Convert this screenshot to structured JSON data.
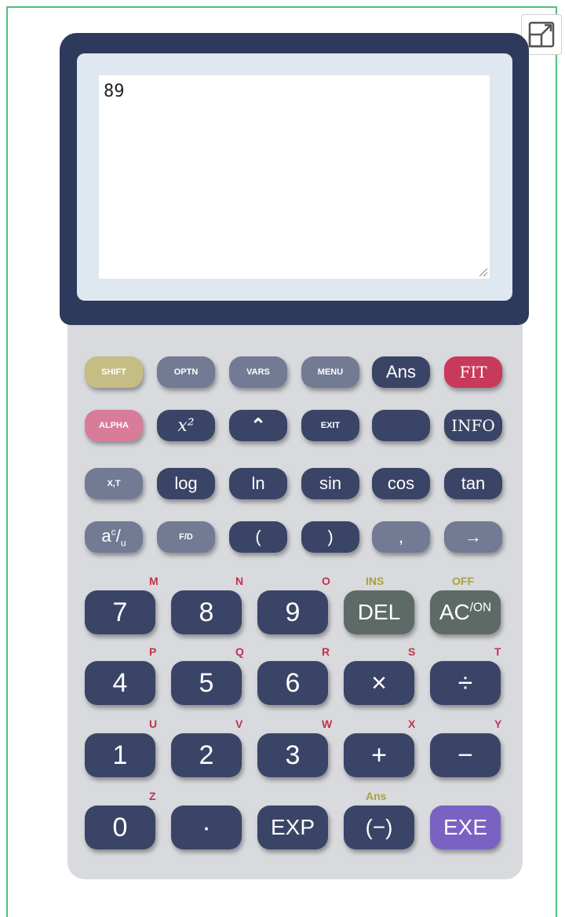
{
  "display": {
    "value": "89"
  },
  "colors": {
    "housing": "#2e3a5c",
    "navy_key": "#3a4466",
    "grey_key": "#737a93",
    "shift": "#c5bd84",
    "alpha": "#d87c99",
    "fit": "#c83a5a",
    "del_ac": "#5e6a66",
    "exe": "#7a62c2",
    "sub_red": "#c2324e",
    "sub_olive": "#a9a33a"
  },
  "rows_small": [
    [
      {
        "label": "SHIFT",
        "name": "shift-key",
        "color": "shift"
      },
      {
        "label": "OPTN",
        "name": "optn-key",
        "color": "grey"
      },
      {
        "label": "VARS",
        "name": "vars-key",
        "color": "grey"
      },
      {
        "label": "MENU",
        "name": "menu-key",
        "color": "grey"
      },
      {
        "label": "Ans",
        "name": "ans-key",
        "color": "navy"
      },
      {
        "label": "FIT",
        "name": "fit-key",
        "color": "fit"
      }
    ],
    [
      {
        "label": "ALPHA",
        "name": "alpha-key",
        "color": "alpha"
      },
      {
        "label": "x²",
        "name": "square-key",
        "color": "navy"
      },
      {
        "label": "^",
        "name": "power-key",
        "color": "navy"
      },
      {
        "label": "EXIT",
        "name": "exit-key",
        "color": "navy"
      },
      {
        "label": "",
        "name": "blank-key",
        "color": "navy"
      },
      {
        "label": "INFO",
        "name": "info-key",
        "color": "navy"
      }
    ],
    [
      {
        "label": "X,T",
        "name": "xt-key",
        "color": "grey"
      },
      {
        "label": "log",
        "name": "log-key",
        "color": "navy"
      },
      {
        "label": "ln",
        "name": "ln-key",
        "color": "navy"
      },
      {
        "label": "sin",
        "name": "sin-key",
        "color": "navy"
      },
      {
        "label": "cos",
        "name": "cos-key",
        "color": "navy"
      },
      {
        "label": "tan",
        "name": "tan-key",
        "color": "navy"
      }
    ],
    [
      {
        "label": "ab/c",
        "name": "fraction-key",
        "color": "grey"
      },
      {
        "label": "F/D",
        "name": "fd-key",
        "color": "grey"
      },
      {
        "label": "(",
        "name": "open-paren-key",
        "color": "navy"
      },
      {
        "label": ")",
        "name": "close-paren-key",
        "color": "navy"
      },
      {
        "label": ",",
        "name": "comma-key",
        "color": "grey"
      },
      {
        "label": "→",
        "name": "arrow-key",
        "color": "grey"
      }
    ]
  ],
  "rows_big": [
    [
      {
        "label": "7",
        "name": "key-7",
        "sub": "M"
      },
      {
        "label": "8",
        "name": "key-8",
        "sub": "N"
      },
      {
        "label": "9",
        "name": "key-9",
        "sub": "O"
      },
      {
        "label": "DEL",
        "name": "del-key",
        "sub": "INS"
      },
      {
        "label": "AC/ON",
        "name": "ac-key",
        "sub": "OFF"
      }
    ],
    [
      {
        "label": "4",
        "name": "key-4",
        "sub": "P"
      },
      {
        "label": "5",
        "name": "key-5",
        "sub": "Q"
      },
      {
        "label": "6",
        "name": "key-6",
        "sub": "R"
      },
      {
        "label": "×",
        "name": "multiply-key",
        "sub": "S"
      },
      {
        "label": "÷",
        "name": "divide-key",
        "sub": "T"
      }
    ],
    [
      {
        "label": "1",
        "name": "key-1",
        "sub": "U"
      },
      {
        "label": "2",
        "name": "key-2",
        "sub": "V"
      },
      {
        "label": "3",
        "name": "key-3",
        "sub": "W"
      },
      {
        "label": "+",
        "name": "plus-key",
        "sub": "X"
      },
      {
        "label": "−",
        "name": "minus-key",
        "sub": "Y"
      }
    ],
    [
      {
        "label": "0",
        "name": "key-0",
        "sub": "Z"
      },
      {
        "label": "·",
        "name": "decimal-key",
        "sub": ""
      },
      {
        "label": "EXP",
        "name": "exp-key",
        "sub": ""
      },
      {
        "label": "(−)",
        "name": "negate-key",
        "sub": "Ans"
      },
      {
        "label": "EXE",
        "name": "exe-key",
        "sub": ""
      }
    ]
  ]
}
